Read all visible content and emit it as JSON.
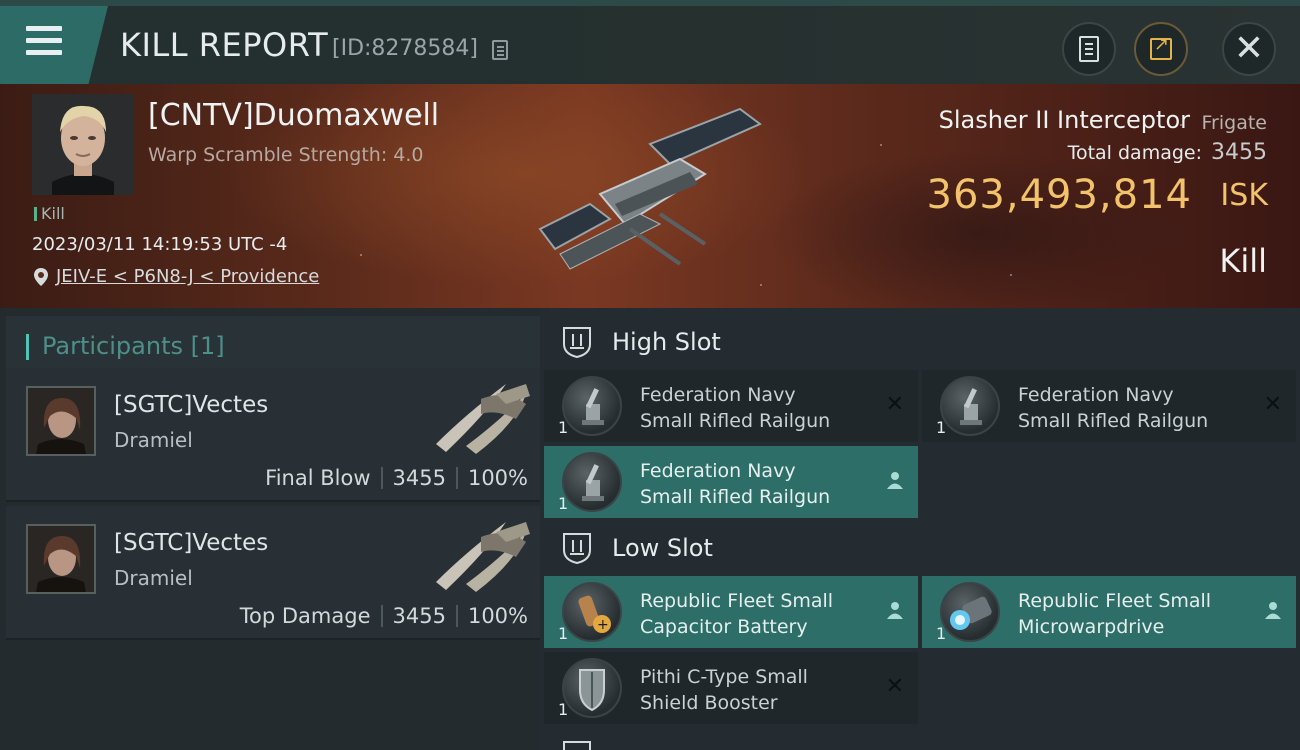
{
  "header": {
    "title": "KILL REPORT",
    "report_id": "[ID:8278584]",
    "icons": {
      "menu": "menu-icon",
      "copy": "copy-icon",
      "notes": "notes-icon",
      "share": "share-icon",
      "close": "close-icon"
    }
  },
  "victim": {
    "name": "[CNTV]Duomaxwell",
    "warp_scramble": "Warp Scramble Strength: 4.0",
    "kill_tag": "Kill",
    "time": "2023/03/11 14:19:53 UTC -4",
    "location": "JEIV-E < P6N8-J < Providence",
    "ship_name": "Slasher II Interceptor",
    "ship_class": "Frigate",
    "total_damage_label": "Total damage:",
    "total_damage": "3455",
    "isk_value": "363,493,814",
    "isk_label": "ISK",
    "result": "Kill"
  },
  "participants": {
    "title": "Participants [1]",
    "items": [
      {
        "name": "[SGTC]Vectes",
        "ship": "Dramiel",
        "role": "Final Blow",
        "damage": "3455",
        "percent": "100%"
      },
      {
        "name": "[SGTC]Vectes",
        "ship": "Dramiel",
        "role": "Top Damage",
        "damage": "3455",
        "percent": "100%"
      }
    ]
  },
  "slots": {
    "high_label": "High Slot",
    "low_label": "Low Slot",
    "high": [
      {
        "line1": "Federation Navy",
        "line2": "Small Rifled Railgun",
        "qty": "1",
        "state": "destroyed",
        "status_icon": "close-icon"
      },
      {
        "line1": "Federation Navy",
        "line2": "Small Rifled Railgun",
        "qty": "1",
        "state": "destroyed",
        "status_icon": "close-icon"
      },
      {
        "line1": "Federation Navy",
        "line2": "Small Rifled Railgun",
        "qty": "1",
        "state": "dropped",
        "status_icon": "person-icon"
      }
    ],
    "low": [
      {
        "line1": "Republic Fleet Small",
        "line2": "Capacitor Battery",
        "qty": "1",
        "state": "dropped",
        "status_icon": "person-icon"
      },
      {
        "line1": "Republic Fleet Small",
        "line2": "Microwarpdrive",
        "qty": "1",
        "state": "dropped",
        "status_icon": "person-icon"
      },
      {
        "line1": "Pithi C-Type Small",
        "line2": "Shield Booster",
        "qty": "1",
        "state": "destroyed",
        "status_icon": "close-icon"
      }
    ]
  },
  "colors": {
    "accent_teal": "#2d6e69",
    "isk_gold": "#f2c36b",
    "banner_red": "#7a3822"
  }
}
